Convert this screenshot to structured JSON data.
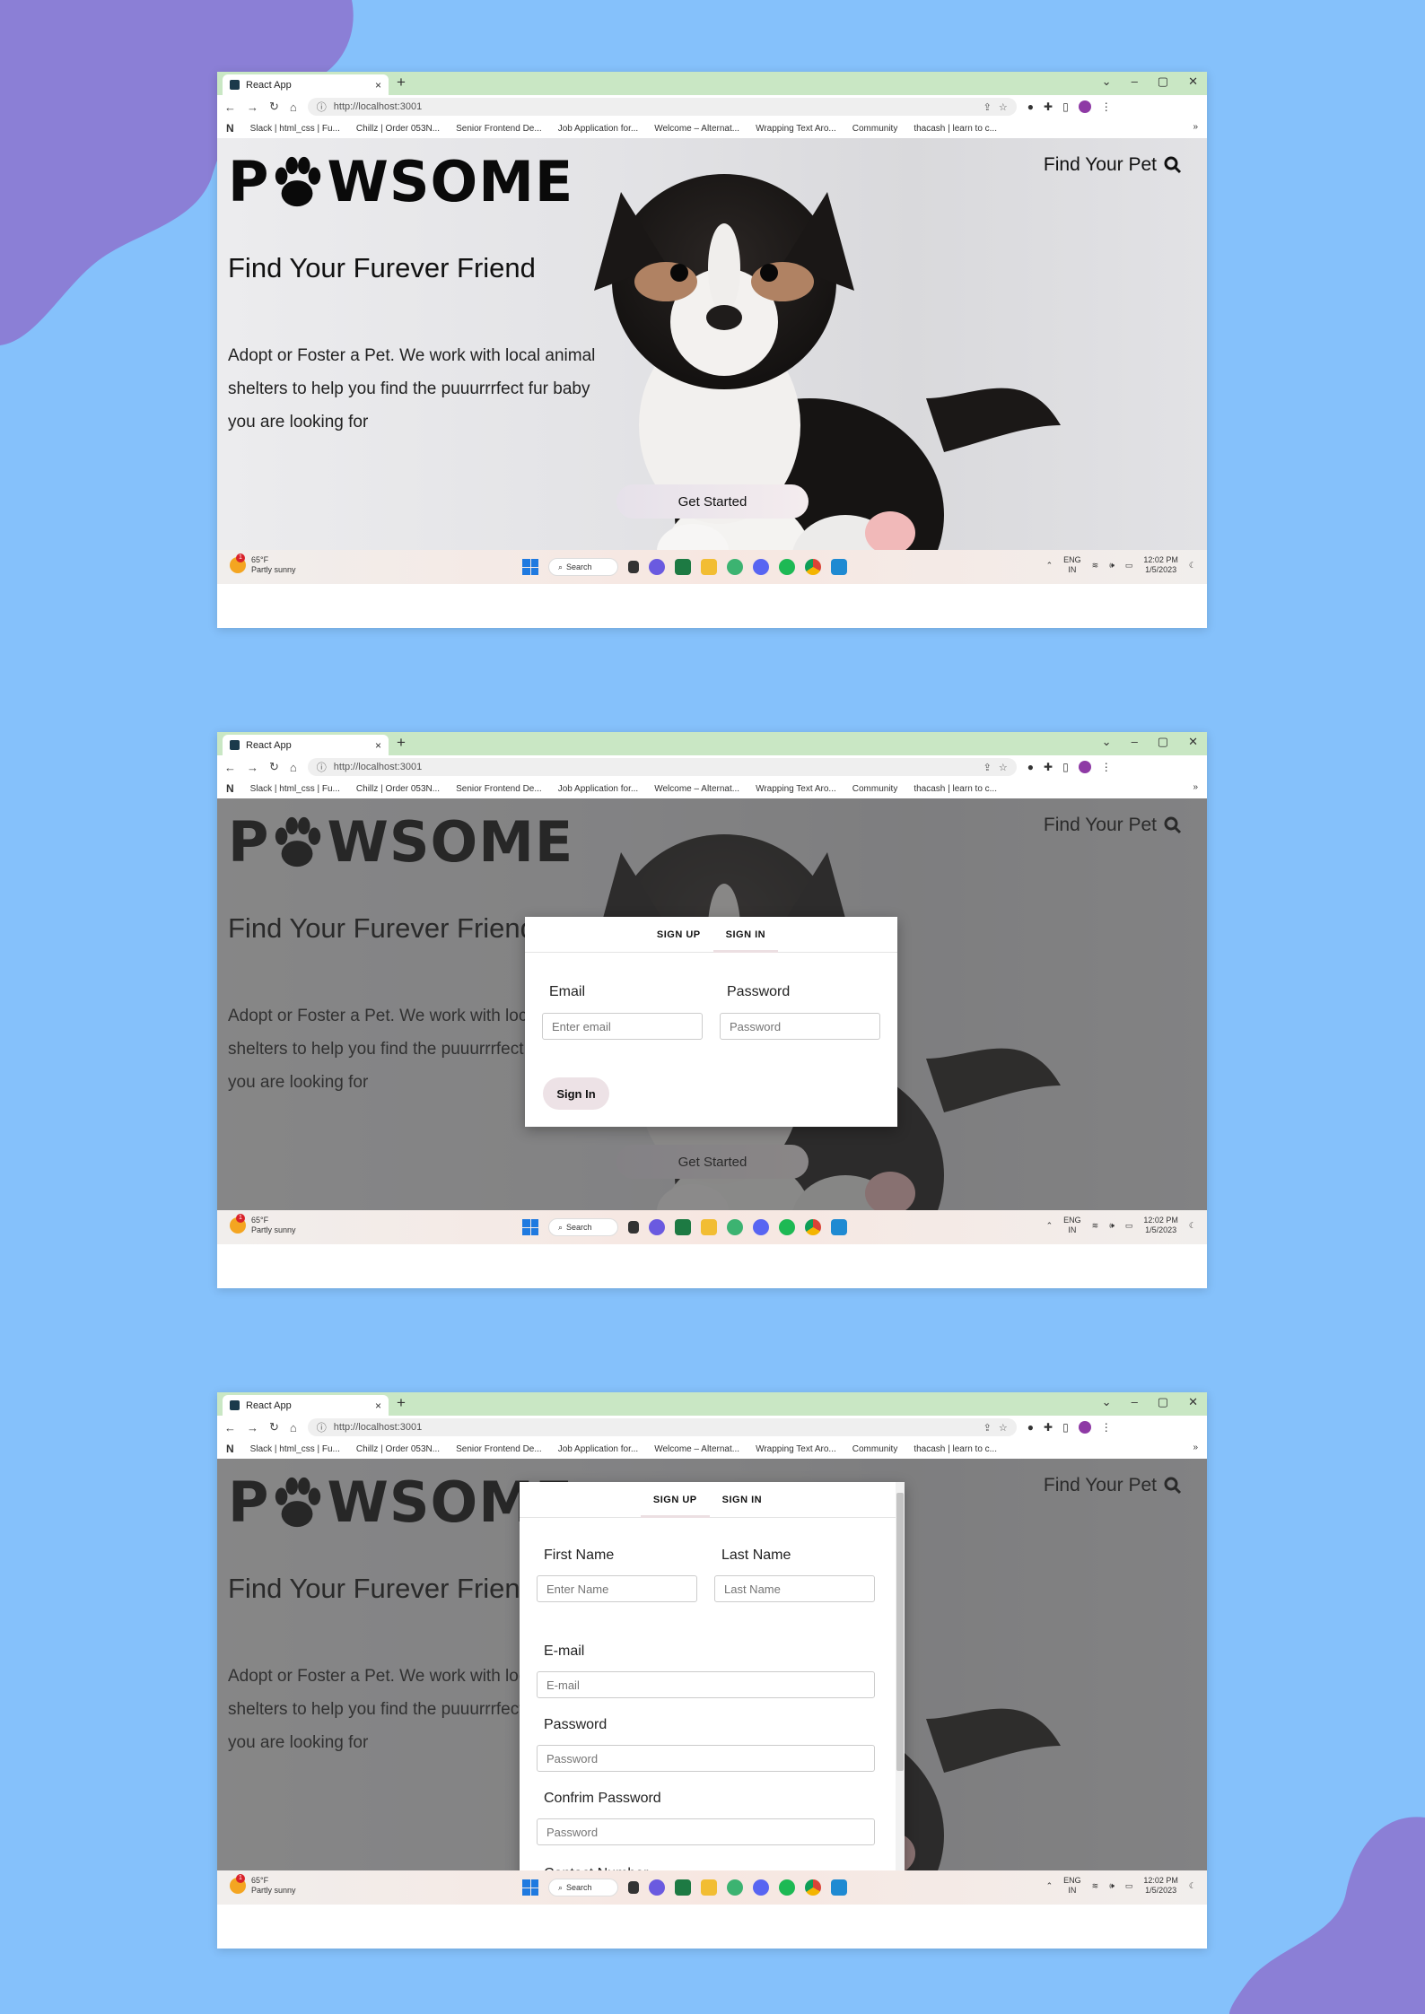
{
  "colors": {
    "background": "#85c1fb",
    "blob": "#8b7fd6",
    "tab_strip": "#c9e7c4",
    "cta_bg": "#ede2e6"
  },
  "browser": {
    "tab_title": "React App",
    "tab_close": "×",
    "new_tab": "+",
    "window_controls": [
      "⌄",
      "–",
      "▢",
      "✕"
    ],
    "url": "http://localhost:3001",
    "bookmarks": [
      "Slack | html_css | Fu...",
      "Chillz | Order 053N...",
      "Senior Frontend De...",
      "Job Application for...",
      "Welcome – Alternat...",
      "Wrapping Text Aro...",
      "Community",
      "thacash | learn to c..."
    ],
    "bookmarks_more": "»",
    "bookmark_n": "N"
  },
  "page": {
    "logo_left": "P",
    "logo_right": "WSOME",
    "find_pet": "Find Your Pet",
    "hero_title": "Find Your Furever Friend",
    "hero_text": "Adopt or Foster a Pet. We work with local animal shelters to help you find the puuurrrfect fur baby you are looking for",
    "cta": "Get Started"
  },
  "signin_modal": {
    "tabs": [
      "SIGN UP",
      "SIGN IN"
    ],
    "active_tab": "SIGN IN",
    "email_label": "Email",
    "email_placeholder": "Enter email",
    "password_label": "Password",
    "password_placeholder": "Password",
    "submit": "Sign In"
  },
  "signup_modal": {
    "tabs": [
      "SIGN UP",
      "SIGN IN"
    ],
    "active_tab": "SIGN UP",
    "first_name_label": "First Name",
    "first_name_placeholder": "Enter Name",
    "last_name_label": "Last Name",
    "last_name_placeholder": "Last Name",
    "email_label": "E-mail",
    "email_placeholder": "E-mail",
    "password_label": "Password",
    "password_placeholder": "Password",
    "confirm_label": "Confrim Password",
    "confirm_placeholder": "Password",
    "contact_label": "Contact Number"
  },
  "taskbar": {
    "temp": "65°F",
    "weather": "Partly sunny",
    "search": "Search",
    "lang_1": "ENG",
    "lang_2": "IN",
    "time": "12:02 PM",
    "date": "1/5/2023"
  },
  "icons": [
    "tab-favicon-icon",
    "back-icon",
    "forward-icon",
    "reload-icon",
    "home-icon",
    "info-icon",
    "share-icon",
    "star-icon",
    "extension-icon",
    "puzzle-icon",
    "sidepanel-icon",
    "profile-icon",
    "menu-icon",
    "search-icon",
    "paw-icon",
    "windows-icon",
    "chevron-up-icon",
    "wifi-icon",
    "volume-icon",
    "battery-icon"
  ]
}
